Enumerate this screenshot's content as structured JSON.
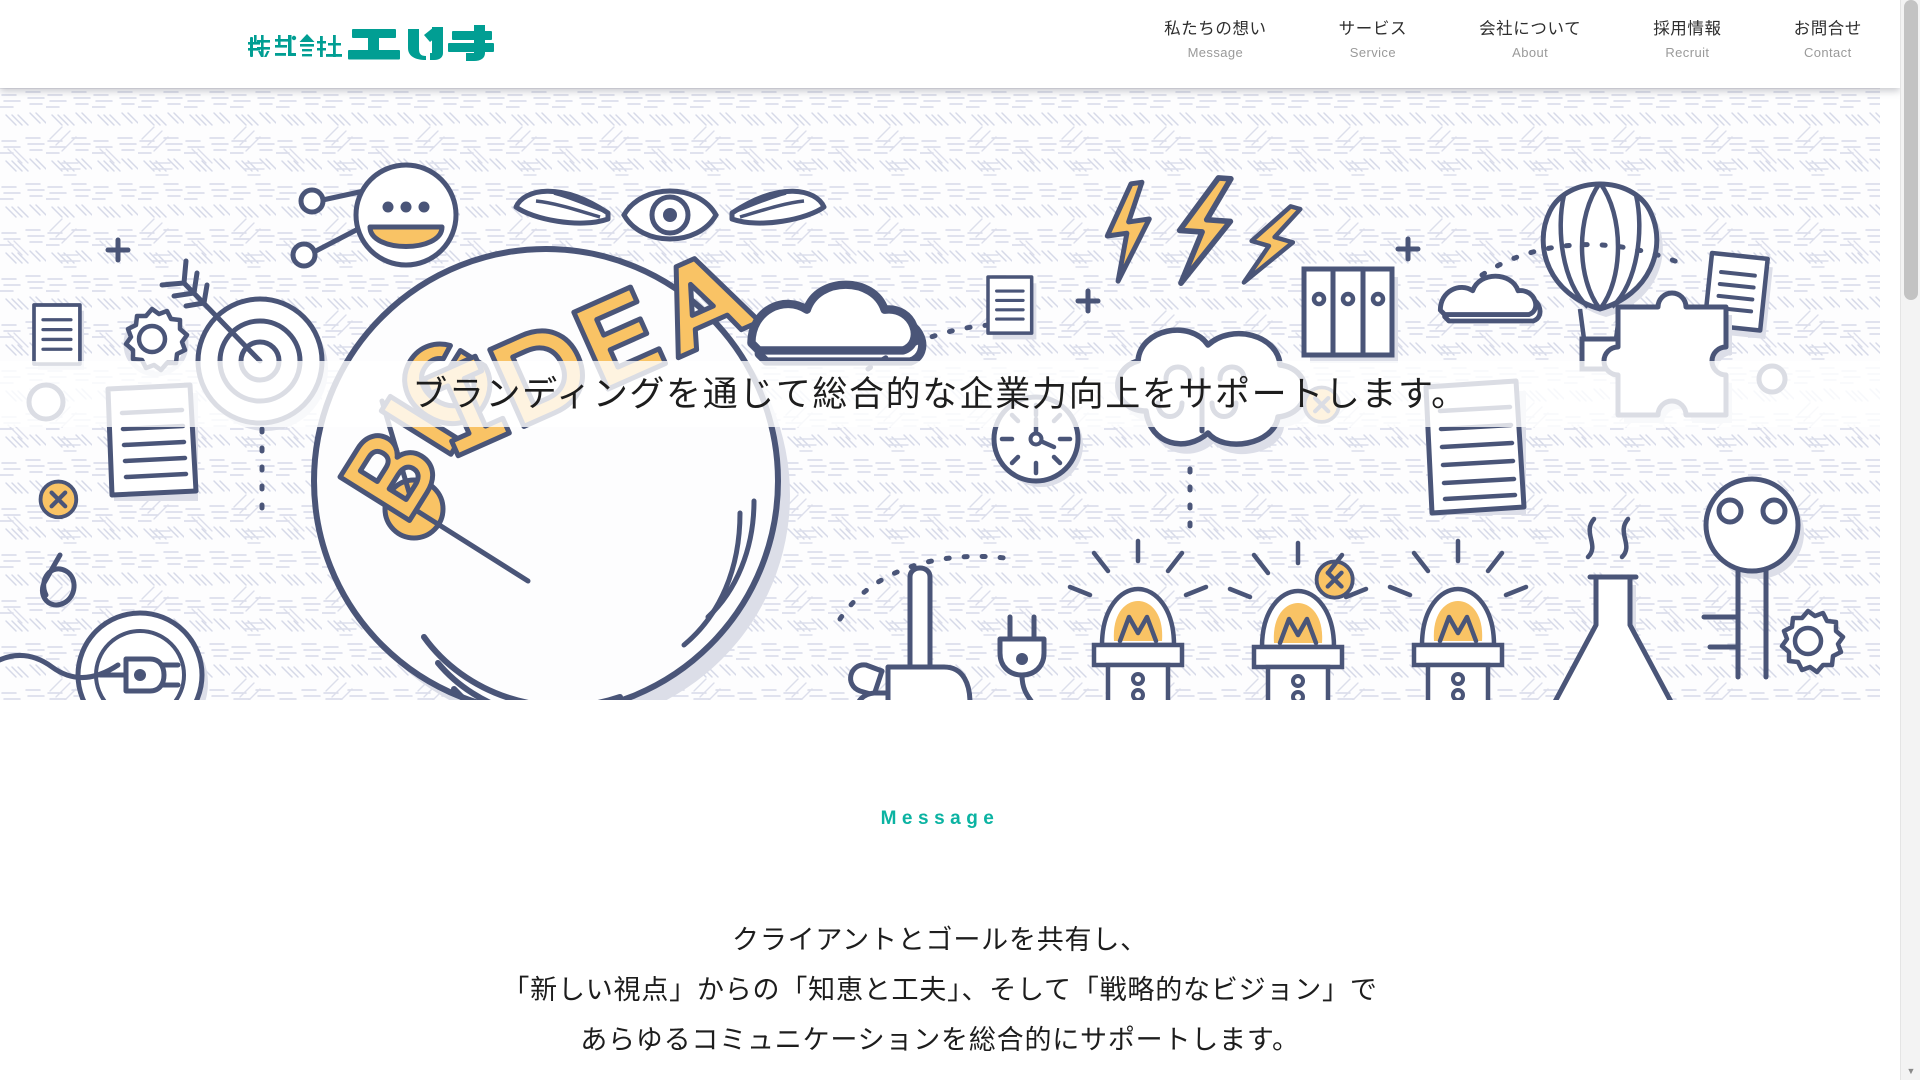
{
  "site": {
    "title": "株式会社エルモ",
    "brand_color": "#019e93",
    "accent_color": "#0bb3a2",
    "ink_color": "#4a5578",
    "amber_color": "#f9c365"
  },
  "header": {
    "logo": {
      "name": "elmo-logo",
      "kanji": "株式会社",
      "katakana": "エルモ",
      "color": "#019e93"
    },
    "nav": [
      {
        "ja": "私たちの想い",
        "en": "Message",
        "name": "nav-item-message"
      },
      {
        "ja": "サービス",
        "en": "Service",
        "name": "nav-item-service"
      },
      {
        "ja": "会社について",
        "en": "About",
        "name": "nav-item-about"
      },
      {
        "ja": "採用情報",
        "en": "Recruit",
        "name": "nav-item-recruit"
      },
      {
        "ja": "お問合せ",
        "en": "Contact",
        "name": "nav-item-contact"
      }
    ]
  },
  "hero": {
    "caption": "ブランディングを通じて総合的な企業力向上をサポートします。",
    "illustration": {
      "name": "big-idea-doodle-banner",
      "word_big": "BIG",
      "word_idea": "IDEA",
      "line_color": "#4a5578",
      "highlight_color": "#f9c365",
      "shadow_color": "#dcdee8",
      "background_color": "#fdfdfe",
      "motifs": [
        "lightbulb",
        "big-idea-lettering",
        "target-with-arrow",
        "gear",
        "document",
        "clock",
        "cloud",
        "brain-cloud",
        "lightning-bolt",
        "hot-air-balloon",
        "books",
        "puzzle-piece",
        "magnifier",
        "pointing-hand",
        "plug",
        "key",
        "flask",
        "x-badge",
        "robot-face",
        "winged-eye",
        "paperclip",
        "light-bulb-row"
      ]
    }
  },
  "message": {
    "eyebrow": "Message",
    "lines": [
      "クライアントとゴールを共有し、",
      "「新しい視点」からの「知恵と工夫」、そして「戦略的なビジョン」で",
      "あらゆるコミュニケーションを総合的にサポートします。"
    ]
  },
  "scrollbar": {
    "up_arrow": "▲",
    "down_arrow": "▼"
  }
}
